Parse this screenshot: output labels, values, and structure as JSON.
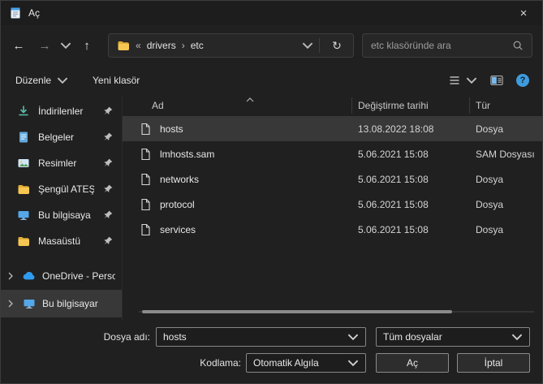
{
  "window": {
    "title": "Aç",
    "close_glyph": "×"
  },
  "nav": {
    "back_glyph": "←",
    "forward_glyph": "→",
    "up_glyph": "↑",
    "refresh_glyph": "↻",
    "breadcrumb": {
      "collapsed_glyph": "«",
      "folder": "drivers",
      "separator_glyph": "›",
      "current": "etc"
    },
    "search": {
      "placeholder": "etc klasöründe ara"
    }
  },
  "toolbar": {
    "organize_label": "Düzenle",
    "new_folder_label": "Yeni klasör",
    "help_glyph": "?"
  },
  "sidebar": {
    "pinned": [
      {
        "label": "İndirilenler",
        "icon": "download",
        "pinned": true
      },
      {
        "label": "Belgeler",
        "icon": "document",
        "pinned": true
      },
      {
        "label": "Resimler",
        "icon": "pictures",
        "pinned": true
      },
      {
        "label": "Şengül ATEŞ",
        "icon": "folder",
        "pinned": true
      },
      {
        "label": "Bu bilgisaya",
        "icon": "computer",
        "pinned": true
      },
      {
        "label": "Masaüstü",
        "icon": "folder",
        "pinned": true
      }
    ],
    "tree": [
      {
        "label": "OneDrive - Perso",
        "icon": "onedrive"
      },
      {
        "label": "Bu bilgisayar",
        "icon": "computer",
        "selected": true
      }
    ]
  },
  "file_list": {
    "columns": {
      "name": "Ad",
      "modified": "Değiştirme tarihi",
      "type": "Tür"
    },
    "rows": [
      {
        "name": "hosts",
        "modified": "13.08.2022 18:08",
        "type": "Dosya",
        "selected": true
      },
      {
        "name": "lmhosts.sam",
        "modified": "5.06.2021 15:08",
        "type": "SAM Dosyası"
      },
      {
        "name": "networks",
        "modified": "5.06.2021 15:08",
        "type": "Dosya"
      },
      {
        "name": "protocol",
        "modified": "5.06.2021 15:08",
        "type": "Dosya"
      },
      {
        "name": "services",
        "modified": "5.06.2021 15:08",
        "type": "Dosya"
      }
    ]
  },
  "footer": {
    "filename_label": "Dosya adı:",
    "filename_value": "hosts",
    "filetype_value": "Tüm dosyalar",
    "encoding_label": "Kodlama:",
    "encoding_value": "Otomatik Algıla",
    "open_label": "Aç",
    "cancel_label": "İptal"
  }
}
